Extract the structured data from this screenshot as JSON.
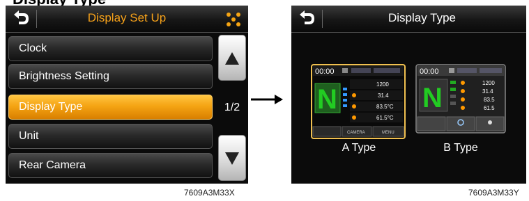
{
  "page_heading_fragment": "Display Type",
  "left_screen": {
    "header": {
      "title": "Display Set Up",
      "back_icon": "back-arrow-icon",
      "menu_icon": "dots-icon"
    },
    "menu_items": [
      {
        "label": "Clock",
        "active": false
      },
      {
        "label": "Brightness Setting",
        "active": false
      },
      {
        "label": "Display Type",
        "active": true
      },
      {
        "label": "Unit",
        "active": false
      },
      {
        "label": "Rear Camera",
        "active": false
      }
    ],
    "page_indicator": "1/2",
    "caption": "7609A3M33X",
    "colors": {
      "accent": "#f5a413",
      "header_title": "#f7a21a"
    }
  },
  "right_screen": {
    "header": {
      "title": "Display Type",
      "back_icon": "back-arrow-icon"
    },
    "options": [
      {
        "label": "A Type",
        "selected": true,
        "preview": {
          "clock": "00:00",
          "gear": "N",
          "values": [
            "1200",
            "31.4",
            "83.5°C",
            "61.5°C"
          ],
          "footer": [
            "CAMERA",
            "MENU"
          ]
        }
      },
      {
        "label": "B Type",
        "selected": false,
        "preview": {
          "clock": "00:00",
          "gear": "N",
          "values": [
            "1200",
            "31.4",
            "83.5",
            "61.5"
          ]
        }
      }
    ],
    "caption": "7609A3M33Y"
  }
}
